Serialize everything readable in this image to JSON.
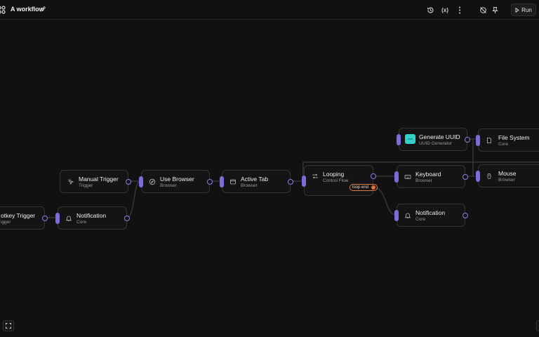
{
  "header": {
    "title": "A workflow",
    "run_label": "Run",
    "icons": [
      "workflow-app-icon",
      "edit-icon",
      "history-icon",
      "variables-icon",
      "more-icon",
      "disable-icon",
      "pin-icon",
      "play-icon"
    ],
    "variables_glyph": "(x)"
  },
  "nodes": [
    {
      "id": "hotkey",
      "title": "otkey Trigger",
      "subtitle": "igger"
    },
    {
      "id": "notification-1",
      "title": "Notification",
      "subtitle": "Core"
    },
    {
      "id": "manual-trigger",
      "title": "Manual Trigger",
      "subtitle": "Trigger"
    },
    {
      "id": "use-browser",
      "title": "Use Browser",
      "subtitle": "Browser"
    },
    {
      "id": "active-tab",
      "title": "Active Tab",
      "subtitle": "Browser"
    },
    {
      "id": "looping",
      "title": "Looping",
      "subtitle": "Control Flow",
      "badge": "loop end"
    },
    {
      "id": "generate-uuid",
      "title": "Generate UUID",
      "subtitle": "UUID Generator",
      "logo_text": "UUID"
    },
    {
      "id": "keyboard",
      "title": "Keyboard",
      "subtitle": "Browser"
    },
    {
      "id": "notification-2",
      "title": "Notification",
      "subtitle": "Core"
    },
    {
      "id": "file-system",
      "title": "File System",
      "subtitle": "Core"
    },
    {
      "id": "mouse",
      "title": "Mouse",
      "subtitle": "Browser"
    }
  ],
  "colors": {
    "background": "#111111",
    "node_bg": "#141414",
    "node_border": "#333333",
    "accent": "#7b6cd9",
    "loop_badge": "#e07a3a",
    "uuid_logo": "#31d1c8"
  }
}
